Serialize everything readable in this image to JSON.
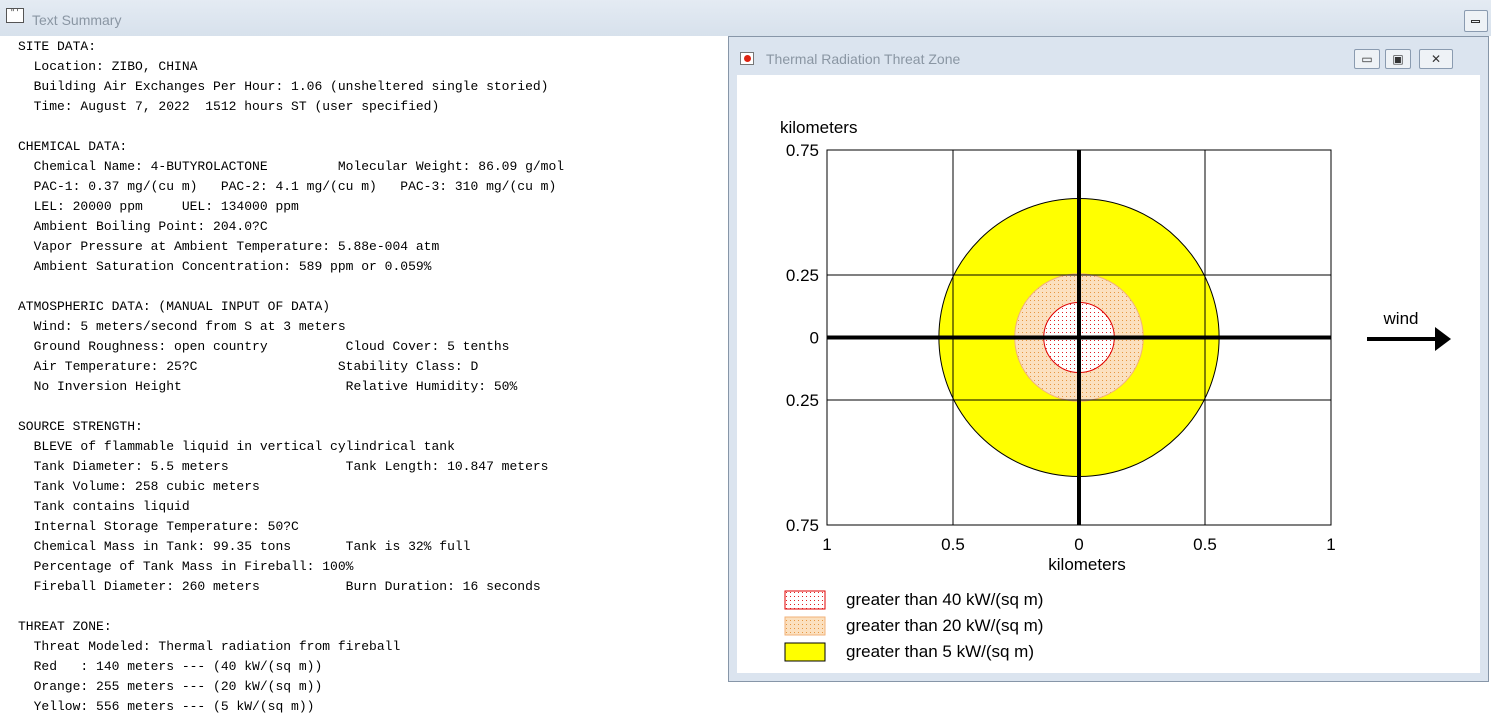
{
  "main_window": {
    "title": "Text Summary",
    "icon": "text-window-icon"
  },
  "report_lines": [
    "SITE DATA:",
    "  Location: ZIBO, CHINA",
    "  Building Air Exchanges Per Hour: 1.06 (unsheltered single storied)",
    "  Time: August 7, 2022  1512 hours ST (user specified)",
    "",
    "CHEMICAL DATA:",
    "  Chemical Name: 4-BUTYROLACTONE         Molecular Weight: 86.09 g/mol",
    "  PAC-1: 0.37 mg/(cu m)   PAC-2: 4.1 mg/(cu m)   PAC-3: 310 mg/(cu m)",
    "  LEL: 20000 ppm     UEL: 134000 ppm",
    "  Ambient Boiling Point: 204.0?C",
    "  Vapor Pressure at Ambient Temperature: 5.88e-004 atm",
    "  Ambient Saturation Concentration: 589 ppm or 0.059%",
    "",
    "ATMOSPHERIC DATA: (MANUAL INPUT OF DATA)",
    "  Wind: 5 meters/second from S at 3 meters",
    "  Ground Roughness: open country          Cloud Cover: 5 tenths",
    "  Air Temperature: 25?C                  Stability Class: D",
    "  No Inversion Height                     Relative Humidity: 50%",
    "",
    "SOURCE STRENGTH:",
    "  BLEVE of flammable liquid in vertical cylindrical tank",
    "  Tank Diameter: 5.5 meters               Tank Length: 10.847 meters",
    "  Tank Volume: 258 cubic meters",
    "  Tank contains liquid",
    "  Internal Storage Temperature: 50?C",
    "  Chemical Mass in Tank: 99.35 tons       Tank is 32% full",
    "  Percentage of Tank Mass in Fireball: 100%",
    "  Fireball Diameter: 260 meters           Burn Duration: 16 seconds",
    "",
    "THREAT ZONE:",
    "  Threat Modeled: Thermal radiation from fireball",
    "  Red   : 140 meters --- (40 kW/(sq m))",
    "  Orange: 255 meters --- (20 kW/(sq m))",
    "  Yellow: 556 meters --- (5 kW/(sq m))"
  ],
  "popup": {
    "title": "Thermal Radiation Threat Zone",
    "icon": "threat-zone-icon",
    "buttons": {
      "minimize": "minimize-icon",
      "restore": "restore-icon",
      "close": "close-icon"
    }
  },
  "chart_data": {
    "type": "threat-zone-plot",
    "units_label_y": "kilometers",
    "units_label_x": "kilometers",
    "y_tick_labels": [
      "0.75",
      "0.25",
      "0",
      "0.25",
      "0.75"
    ],
    "y_tick_values": [
      0.75,
      0.25,
      0,
      -0.25,
      -0.75
    ],
    "x_tick_labels": [
      "1",
      "0.5",
      "0",
      "0.5",
      "1"
    ],
    "x_tick_values": [
      -1,
      -0.5,
      0,
      0.5,
      1
    ],
    "xlim": [
      -1,
      1
    ],
    "ylim": [
      -0.75,
      0.75
    ],
    "grid": true,
    "wind_label": "wind",
    "wind_direction": "east",
    "zones": [
      {
        "name": "Yellow",
        "radius_km": 0.556,
        "color": "#ffff00",
        "pattern": "solid",
        "legend": "greater than 5 kW/(sq m)"
      },
      {
        "name": "Orange",
        "radius_km": 0.255,
        "color": "#f5c38c",
        "pattern": "dots",
        "legend": "greater than 20 kW/(sq m)"
      },
      {
        "name": "Red",
        "radius_km": 0.14,
        "color": "#ff0000",
        "pattern": "dots",
        "legend": "greater than 40 kW/(sq m)"
      }
    ],
    "legend_order": [
      "greater than 40 kW/(sq m)",
      "greater than 20 kW/(sq m)",
      "greater than 5 kW/(sq m)"
    ]
  }
}
